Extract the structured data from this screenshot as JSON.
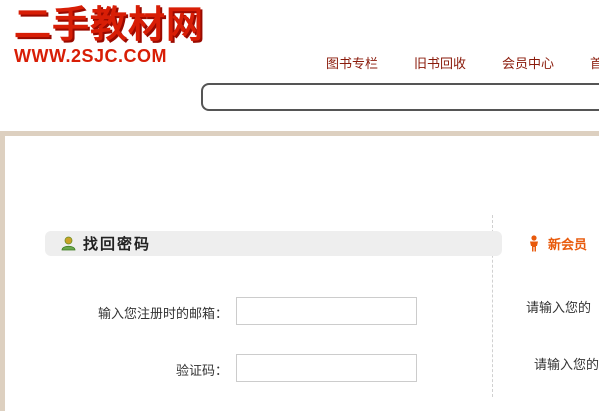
{
  "logo": {
    "title": "二手教材网",
    "url": "WWW.2SJC.COM"
  },
  "nav": {
    "items": [
      {
        "label": "图书专栏"
      },
      {
        "label": "旧书回收"
      },
      {
        "label": "会员中心"
      },
      {
        "label": "首"
      }
    ]
  },
  "search": {
    "placeholder": ""
  },
  "find_password": {
    "title": "找回密码",
    "email_label": "输入您注册时的邮箱：",
    "email_value": "",
    "captcha_label": "验证码：",
    "captcha_value": ""
  },
  "new_member": {
    "title": "新会员",
    "line1": "请输入您的",
    "line2": "请输入您的"
  },
  "colors": {
    "brand_red": "#d81e06",
    "nav_text": "#8a1a0a",
    "accent_orange": "#e85a0c",
    "frame_border": "#ddd0c0"
  }
}
